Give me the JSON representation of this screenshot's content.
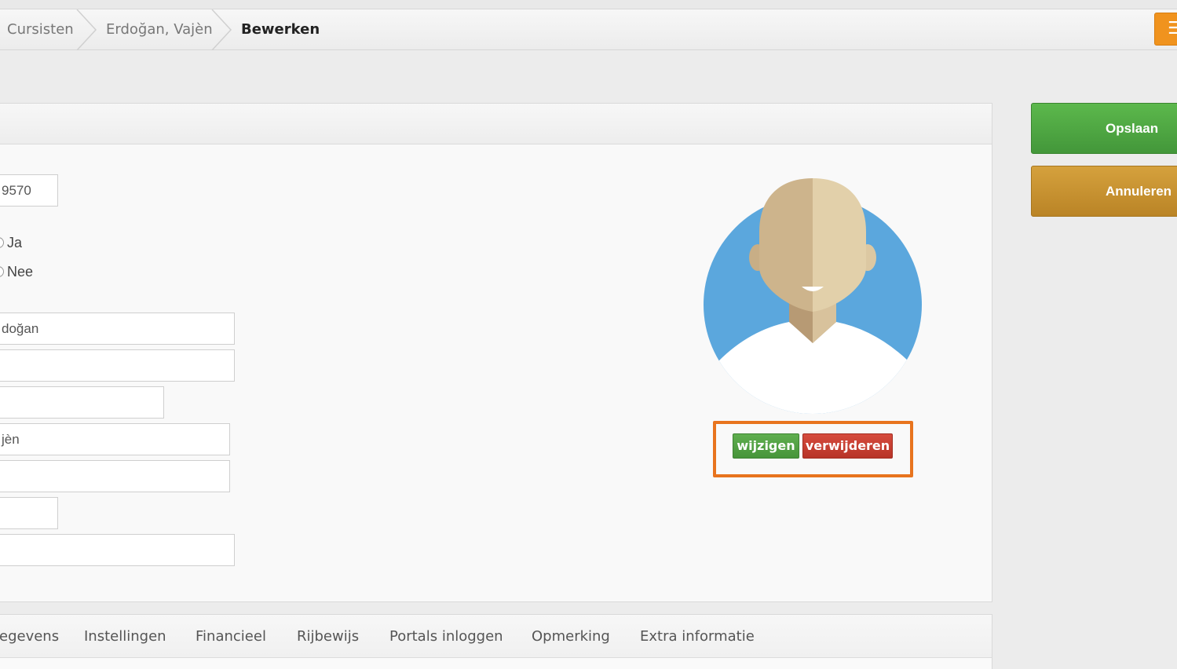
{
  "breadcrumb": {
    "items": [
      "Cursisten",
      "Erdoğan, Vajèn",
      "Bewerken"
    ]
  },
  "form": {
    "number_value": "9570",
    "radio_yes_label": "Ja",
    "radio_no_label": "Nee",
    "lastname_value": "doğan",
    "field_2_value": "",
    "field_3_value": "",
    "firstname_value": "jèn",
    "field_5_value": "",
    "field_6_value": "",
    "field_7_value": ""
  },
  "photo": {
    "change_label": "wijzigen",
    "delete_label": "verwijderen"
  },
  "actions": {
    "save_label": "Opslaan",
    "cancel_label": "Annuleren"
  },
  "tabs": [
    "egevens",
    "Instellingen",
    "Financieel",
    "Rijbewijs",
    "Portals inloggen",
    "Opmerking",
    "Extra informatie"
  ],
  "colors": {
    "highlight_border": "#e8741e",
    "save_green": "#4aa63e",
    "cancel_gold": "#c9922f",
    "delete_red": "#c63c2f",
    "avatar_blue": "#5ba7dd"
  }
}
